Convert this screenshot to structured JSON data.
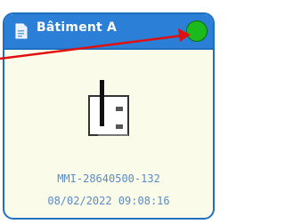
{
  "card": {
    "title": "Bâtiment A",
    "device_id": "MMI-28640500-132",
    "timestamp": "08/02/2022 09:08:16",
    "status_color": "#1dba1d",
    "accent_color": "#2b7fd6"
  },
  "icons": {
    "header": "document-icon",
    "device": "sensor-device-icon",
    "status": "status-online-icon",
    "annotation": "red-arrow-icon"
  }
}
